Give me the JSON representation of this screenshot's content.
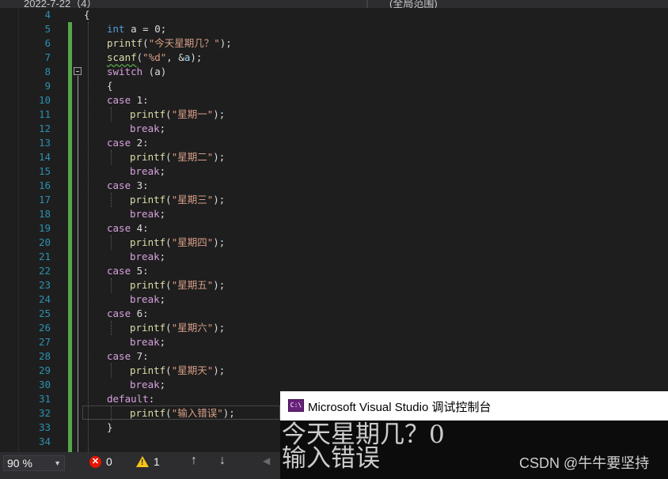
{
  "top_tabs": {
    "left_label": "2022-7-22（4）",
    "right_label": "(全局范围)"
  },
  "line_numbers": [
    "4",
    "5",
    "6",
    "7",
    "8",
    "9",
    "10",
    "11",
    "12",
    "13",
    "14",
    "15",
    "16",
    "17",
    "18",
    "19",
    "20",
    "21",
    "22",
    "23",
    "24",
    "25",
    "26",
    "27",
    "28",
    "29",
    "30",
    "31",
    "32",
    "33",
    "34"
  ],
  "code": {
    "l4_brace": "{",
    "l5_type": "int",
    "l5_rest": " a = 0;",
    "l6_fn": "printf",
    "l6_open": "(",
    "l6_str": "\"今天星期几？\"",
    "l6_close": ");",
    "l7_fn": "scanf",
    "l7_open": "(",
    "l7_str": "\"%d\"",
    "l7_rest": ", &",
    "l7_var": "a",
    "l7_close": ");",
    "l8_kw": "switch",
    "l8_rest": " (a)",
    "l9_brace": "{",
    "case_kw": "case",
    "case_vals": [
      "1:",
      "2:",
      "3:",
      "4:",
      "5:",
      "6:",
      "7:"
    ],
    "day_strings": [
      "\"星期一\"",
      "\"星期二\"",
      "\"星期三\"",
      "\"星期四\"",
      "\"星期五\"",
      "\"星期六\"",
      "\"星期天\""
    ],
    "printf": "printf",
    "paren_open": "(",
    "paren_close": ");",
    "break_kw": "break",
    "semicolon": ";",
    "default_kw": "default",
    "colon": ":",
    "default_str": "\"输入错误\"",
    "close_brace": "}"
  },
  "status": {
    "zoom": "90 %",
    "error_count": "0",
    "warning_count": "1",
    "nav_up": "↑",
    "nav_down": "↓",
    "scroll_left": "◀"
  },
  "console": {
    "title": "Microsoft Visual Studio 调试控制台",
    "icon_text": "C:\\",
    "output_lines": [
      "今天星期几？0",
      "输入错误"
    ],
    "cut_off_line": "...",
    "watermark": "CSDN @牛牛要坚持"
  },
  "colors": {
    "editor_bg": "#1e1e1e",
    "line_number": "#2b91af",
    "keyword": "#569cd6",
    "control": "#d8a0df",
    "function": "#dcdcaa",
    "string": "#d69d85",
    "change_bar": "#57a64a",
    "console_bg": "#0c0c0c"
  }
}
